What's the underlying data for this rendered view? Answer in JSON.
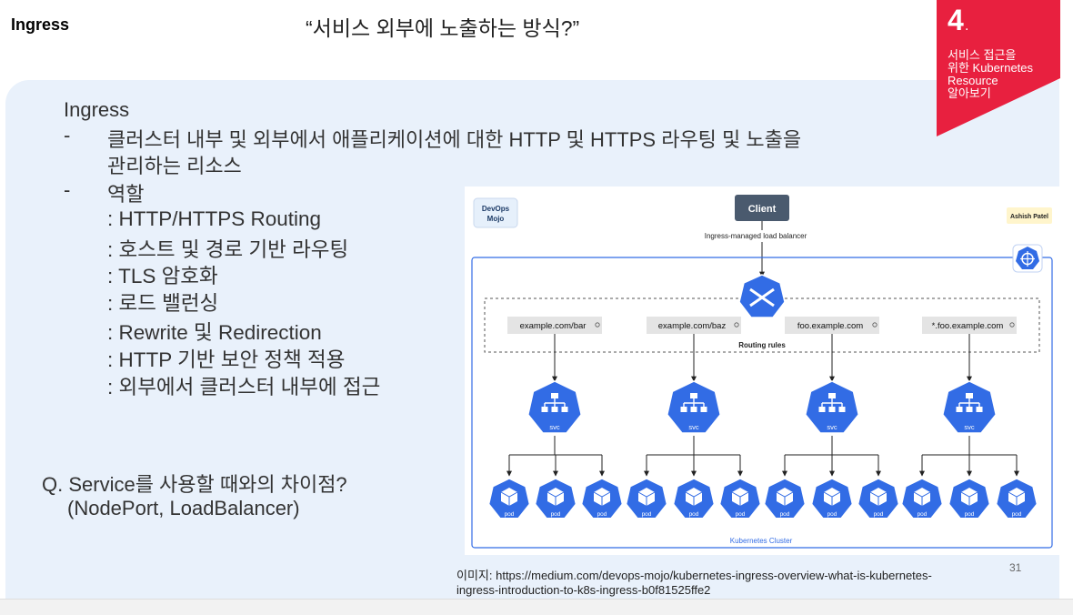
{
  "header": {
    "title": "Ingress",
    "headline": "“서비스 외부에 노출하는 방식?”"
  },
  "badge": {
    "number": "4",
    "dot": ".",
    "lines": [
      "서비스 접근을",
      "위한 Kubernetes",
      "Resource",
      "알아보기"
    ],
    "color": "#e8203f"
  },
  "body": {
    "heading": "Ingress",
    "bullet1_dash": "-",
    "bullet1_line1": "클러스터 내부 및 외부에서 애플리케이션에 대한 HTTP 및 HTTPS 라우팅 및 노출을",
    "bullet1_line2": "관리하는 리소스",
    "bullet2_dash": "-",
    "bullet2_label": "역할",
    "roles": [
      ": HTTP/HTTPS Routing",
      ": 호스트 및 경로 기반 라우팅",
      ": TLS 암호화",
      ": 로드 밸런싱",
      ": Rewrite 및 Redirection",
      ": HTTP 기반 보안 정책 적용",
      ": 외부에서 클러스터 내부에 접근"
    ],
    "question_line1": "Q. Service를 사용할 때와의 차이점?",
    "question_line2": "(NodePort, LoadBalancer)"
  },
  "diagram": {
    "logo_left_line1": "DevOps",
    "logo_left_line2": "Mojo",
    "author": "Ashish Patel",
    "client": "Client",
    "lb_label": "Ingress-managed load balancer",
    "ing_label": "ing",
    "routes": [
      "example.com/bar",
      "example.com/baz",
      "foo.example.com",
      "*.foo.example.com"
    ],
    "routing_rules": "Routing rules",
    "svc_label": "svc",
    "pod_label": "pod",
    "cluster_label": "Kubernetes Cluster",
    "colors": {
      "k8s_blue": "#326ce5",
      "client_box": "#4a5a6e"
    }
  },
  "footer": {
    "caption_line1": "이미지: https://medium.com/devops-mojo/kubernetes-ingress-overview-what-is-kubernetes-",
    "caption_line2": "ingress-introduction-to-k8s-ingress-b0f81525ffe2",
    "slide_number": "31"
  }
}
